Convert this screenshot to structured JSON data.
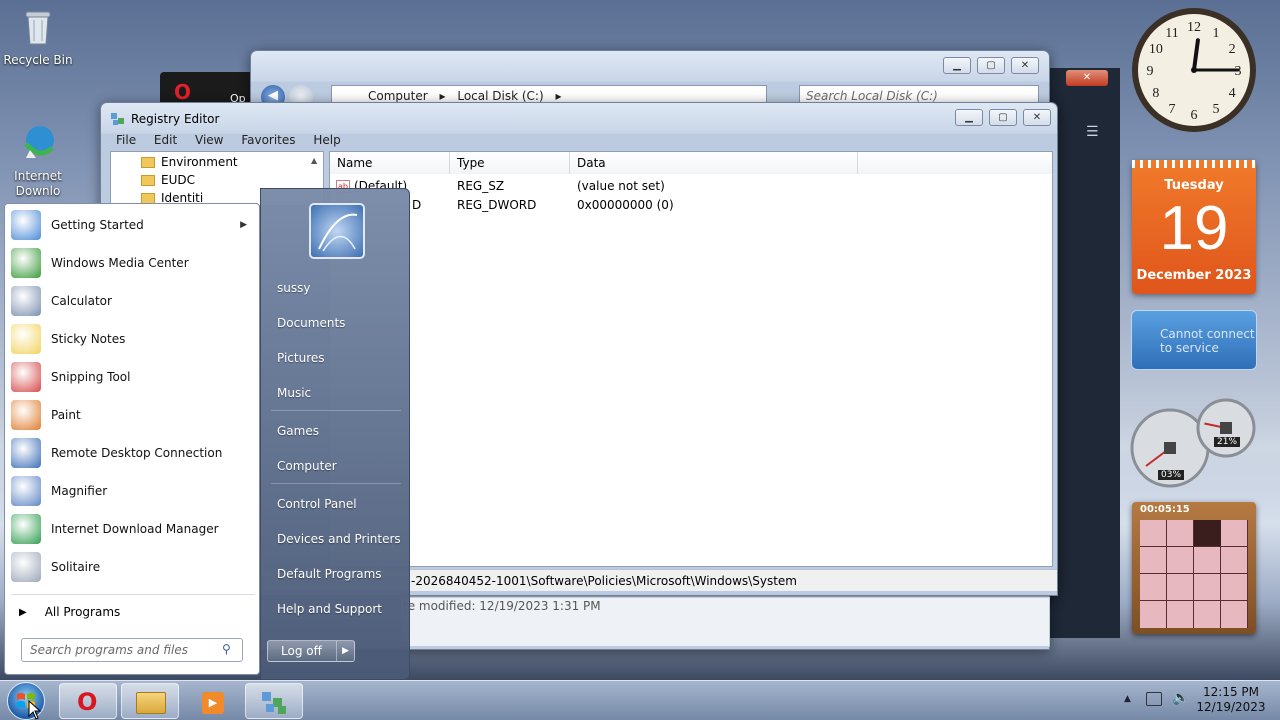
{
  "desktop": {
    "icons": [
      {
        "label": "Recycle Bin",
        "icon": "recycle-bin-icon"
      },
      {
        "label": "Internet Downlo",
        "icon": "idm-icon"
      }
    ],
    "partial_text": "Op"
  },
  "explorer": {
    "address": [
      "Computer",
      "Local Disk (C:)"
    ],
    "search_placeholder": "Search Local Disk (C:)"
  },
  "registry": {
    "title": "Registry Editor",
    "menu": [
      "File",
      "Edit",
      "View",
      "Favorites",
      "Help"
    ],
    "tree": [
      "Environment",
      "EUDC",
      "Identiti"
    ],
    "columns": [
      "Name",
      "Type",
      "Data"
    ],
    "rows": [
      {
        "name": "(Default)",
        "type": "REG_SZ",
        "data": "(value not set)"
      },
      {
        "name": "D",
        "type": "REG_DWORD",
        "data": "0x00000000 (0)"
      }
    ],
    "status_path": "-2026840452-1001\\Software\\Policies\\Microsoft\\Windows\\System",
    "details_modified": "te modified: 12/19/2023 1:31 PM"
  },
  "start_menu": {
    "programs": [
      {
        "label": "Getting Started",
        "has_submenu": true,
        "color": "#4a8bd6"
      },
      {
        "label": "Windows Media Center",
        "has_submenu": false,
        "color": "#3a9a3a"
      },
      {
        "label": "Calculator",
        "has_submenu": false,
        "color": "#7b8fb0"
      },
      {
        "label": "Sticky Notes",
        "has_submenu": false,
        "color": "#f2d35c"
      },
      {
        "label": "Snipping Tool",
        "has_submenu": false,
        "color": "#d64a4a"
      },
      {
        "label": "Paint",
        "has_submenu": false,
        "color": "#e07d2f"
      },
      {
        "label": "Remote Desktop Connection",
        "has_submenu": false,
        "color": "#3c6fb8"
      },
      {
        "label": "Magnifier",
        "has_submenu": false,
        "color": "#5d86c4"
      },
      {
        "label": "Internet Download Manager",
        "has_submenu": false,
        "color": "#2f9e4f"
      },
      {
        "label": "Solitaire",
        "has_submenu": false,
        "color": "#9aa7b8"
      }
    ],
    "all_programs": "All Programs",
    "search_placeholder": "Search programs and files",
    "right_items": [
      "sussy",
      "Documents",
      "Pictures",
      "Music",
      "Games",
      "Computer",
      "Control Panel",
      "Devices and Printers",
      "Default Programs",
      "Help and Support"
    ],
    "logoff": "Log off"
  },
  "gadgets": {
    "calendar": {
      "weekday": "Tuesday",
      "day": "19",
      "month_year": "December 2023"
    },
    "weather": {
      "message": "Cannot connect to service"
    },
    "cpu_meter": {
      "cpu": "03%",
      "memory": "21%",
      "cpu_fraction": 0.03,
      "memory_fraction": 0.21
    },
    "puzzle": {
      "timer": "00:05:15"
    },
    "clock": {
      "hour": 12,
      "minute": 15
    }
  },
  "taskbar": {
    "time": "12:15 PM",
    "date": "12/19/2023"
  }
}
